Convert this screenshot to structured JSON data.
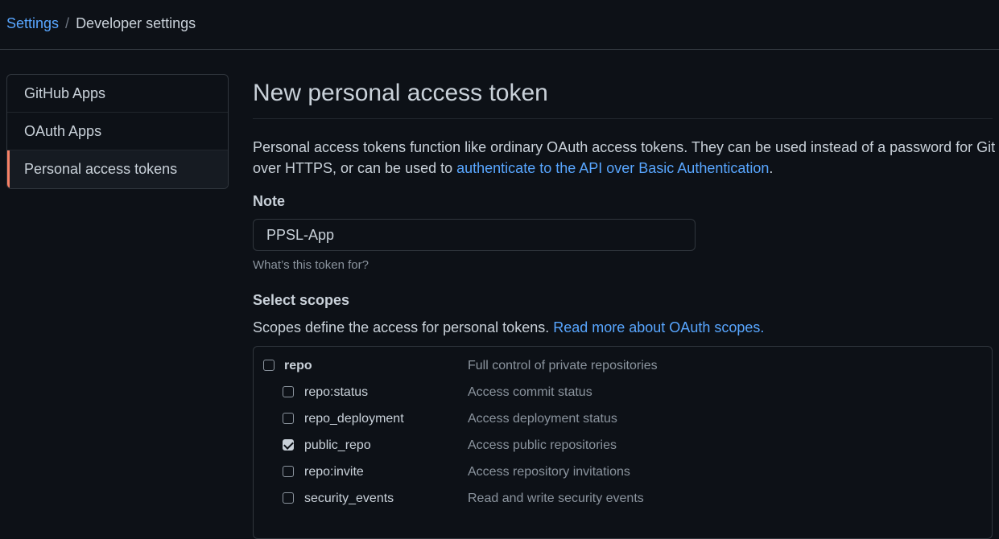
{
  "breadcrumb": {
    "settings": "Settings",
    "separator": "/",
    "current": "Developer settings"
  },
  "sidebar": {
    "items": [
      {
        "label": "GitHub Apps",
        "active": false
      },
      {
        "label": "OAuth Apps",
        "active": false
      },
      {
        "label": "Personal access tokens",
        "active": true
      }
    ]
  },
  "main": {
    "title": "New personal access token",
    "intro_text": "Personal access tokens function like ordinary OAuth access tokens. They can be used instead of a password for Git over HTTPS, or can be used to ",
    "intro_link": "authenticate to the API over Basic Authentication",
    "intro_end": ".",
    "note_label": "Note",
    "note_value": "PPSL-App",
    "note_hint": "What’s this token for?",
    "scopes_label": "Select scopes",
    "scopes_desc": "Scopes define the access for personal tokens. ",
    "scopes_link": "Read more about OAuth scopes."
  },
  "scopes": [
    {
      "name": "repo",
      "desc": "Full control of private repositories",
      "checked": false,
      "parent": true
    },
    {
      "name": "repo:status",
      "desc": "Access commit status",
      "checked": false,
      "parent": false
    },
    {
      "name": "repo_deployment",
      "desc": "Access deployment status",
      "checked": false,
      "parent": false
    },
    {
      "name": "public_repo",
      "desc": "Access public repositories",
      "checked": true,
      "parent": false
    },
    {
      "name": "repo:invite",
      "desc": "Access repository invitations",
      "checked": false,
      "parent": false
    },
    {
      "name": "security_events",
      "desc": "Read and write security events",
      "checked": false,
      "parent": false
    }
  ],
  "colors": {
    "background": "#0d1117",
    "link": "#58a6ff",
    "active_indicator": "#f78166"
  }
}
